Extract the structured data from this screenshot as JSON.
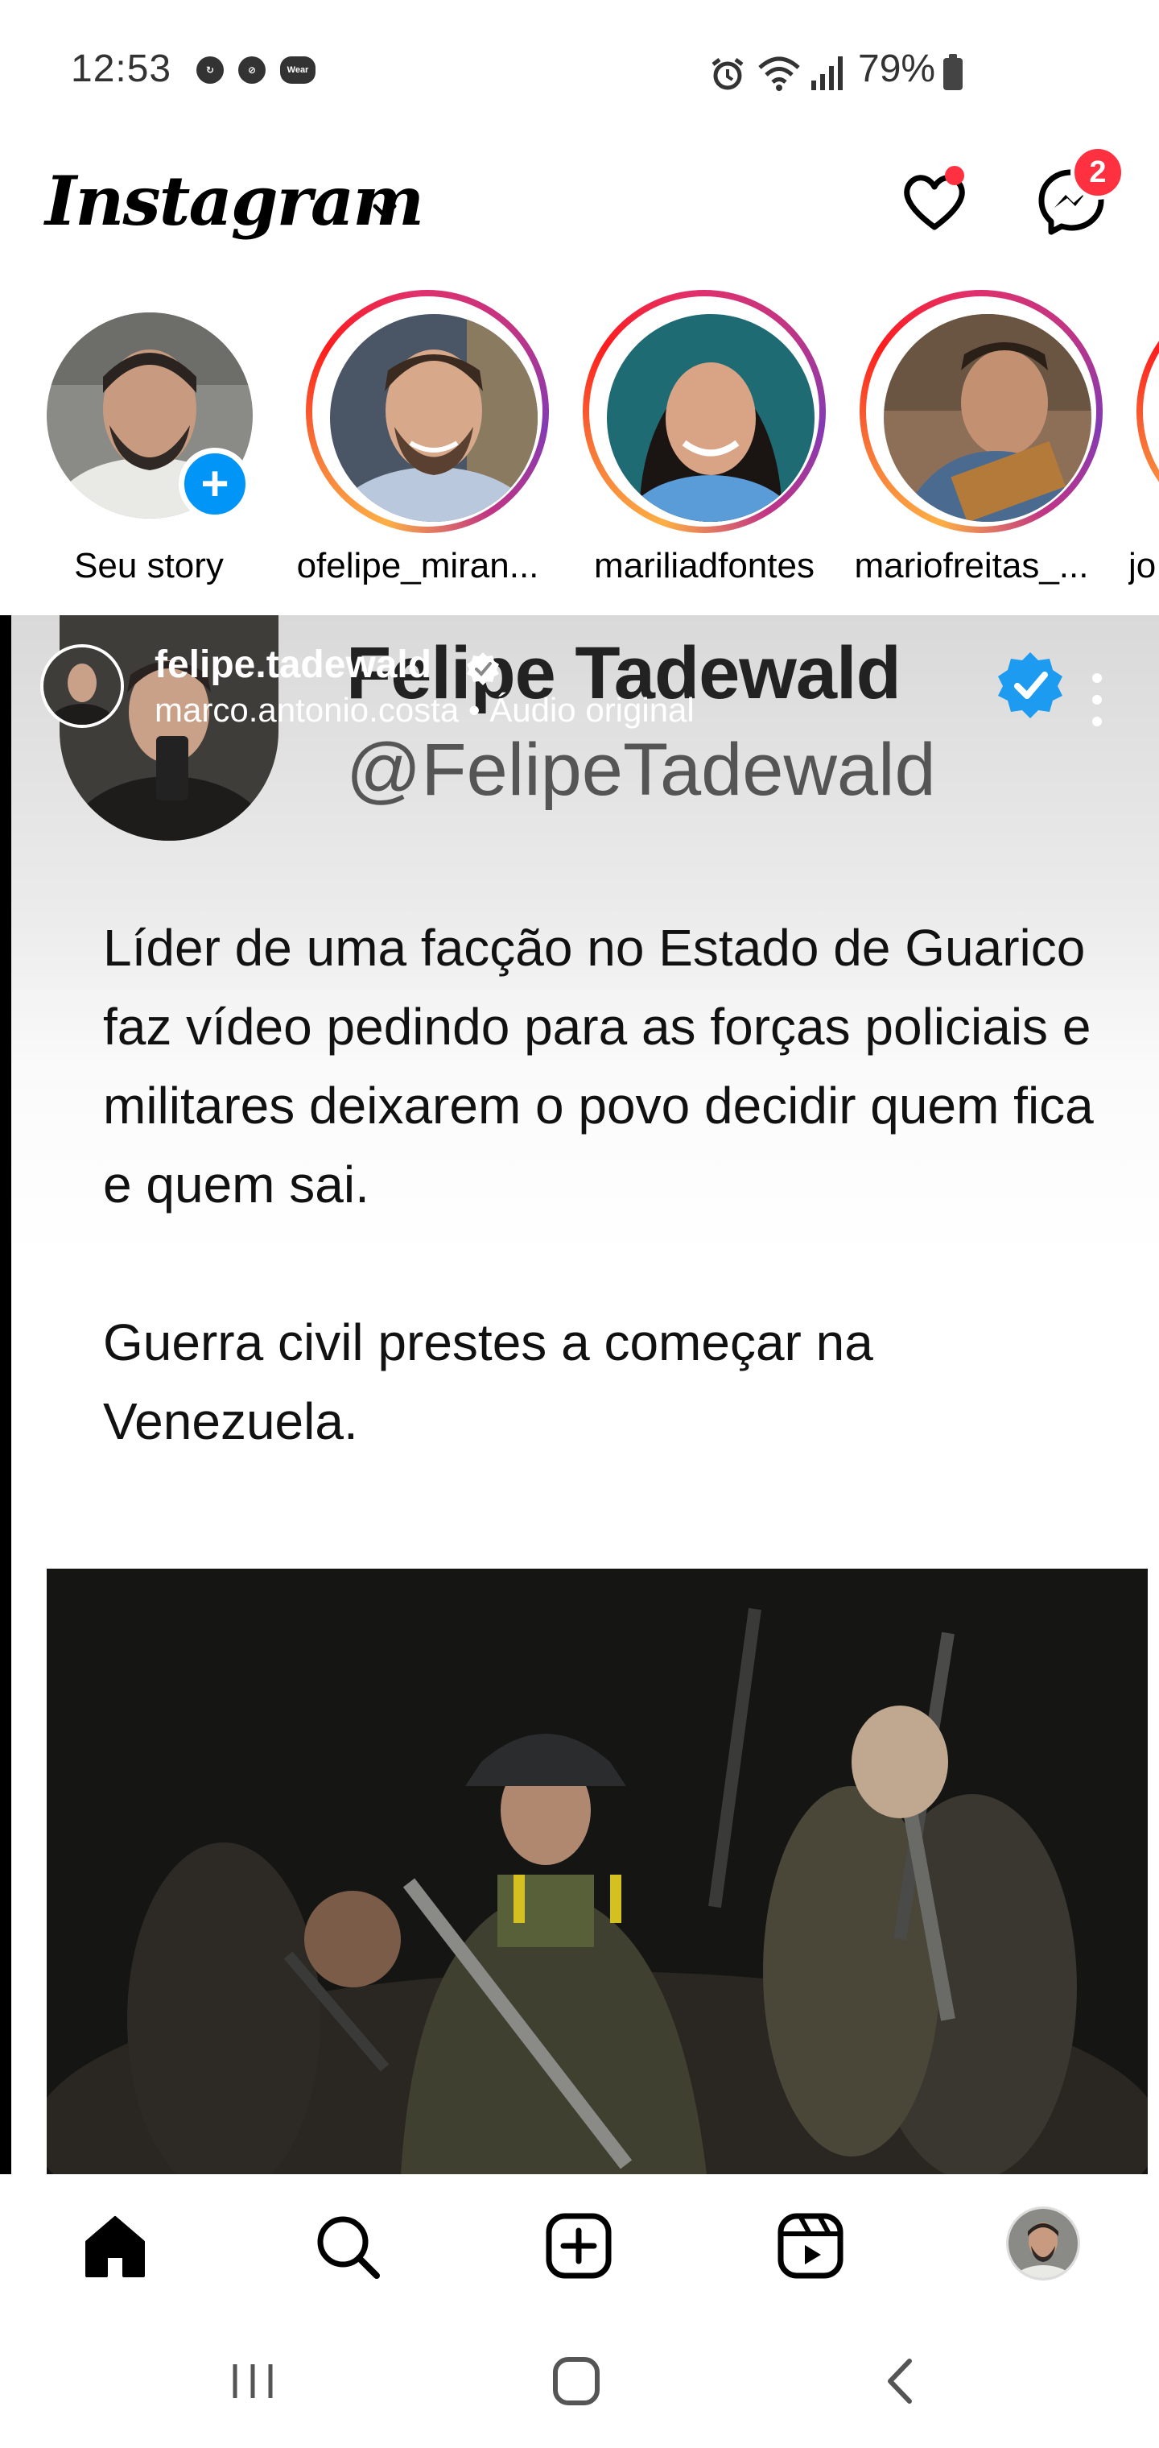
{
  "status_bar": {
    "time": "12:53",
    "left_icons": [
      "sync-icon",
      "no-disturb-icon",
      "wear-icon"
    ],
    "wear_label": "Wear",
    "battery_percent": "79%"
  },
  "header": {
    "logo": "Instagram",
    "notifications_dot": true,
    "messages_badge": "2"
  },
  "stories": [
    {
      "name": "Seu story",
      "own": true
    },
    {
      "name": "ofelipe_miran..."
    },
    {
      "name": "mariliadfontes"
    },
    {
      "name": "mariofreitas_..."
    },
    {
      "name": "jo"
    }
  ],
  "post": {
    "username": "felipe.tadewald",
    "subtitle": "marco.antonio.costa • Áudio original",
    "tweet": {
      "name": "Felipe Tadewald",
      "handle": "@FelipeTadewald",
      "paragraph1": "Líder de uma facção no Estado de Guarico faz vídeo pedindo para as forças policiais e militares deixarem o povo decidir quem fica e quem sai.",
      "paragraph2": "Guerra civil prestes a começar na Venezuela."
    }
  },
  "bottom_nav": [
    "home-icon",
    "search-icon",
    "create-icon",
    "reels-icon",
    "profile-avatar"
  ],
  "colors": {
    "accent_blue": "#0095f6",
    "badge_red": "#ff3040",
    "verified_blue": "#1d9bf0"
  }
}
